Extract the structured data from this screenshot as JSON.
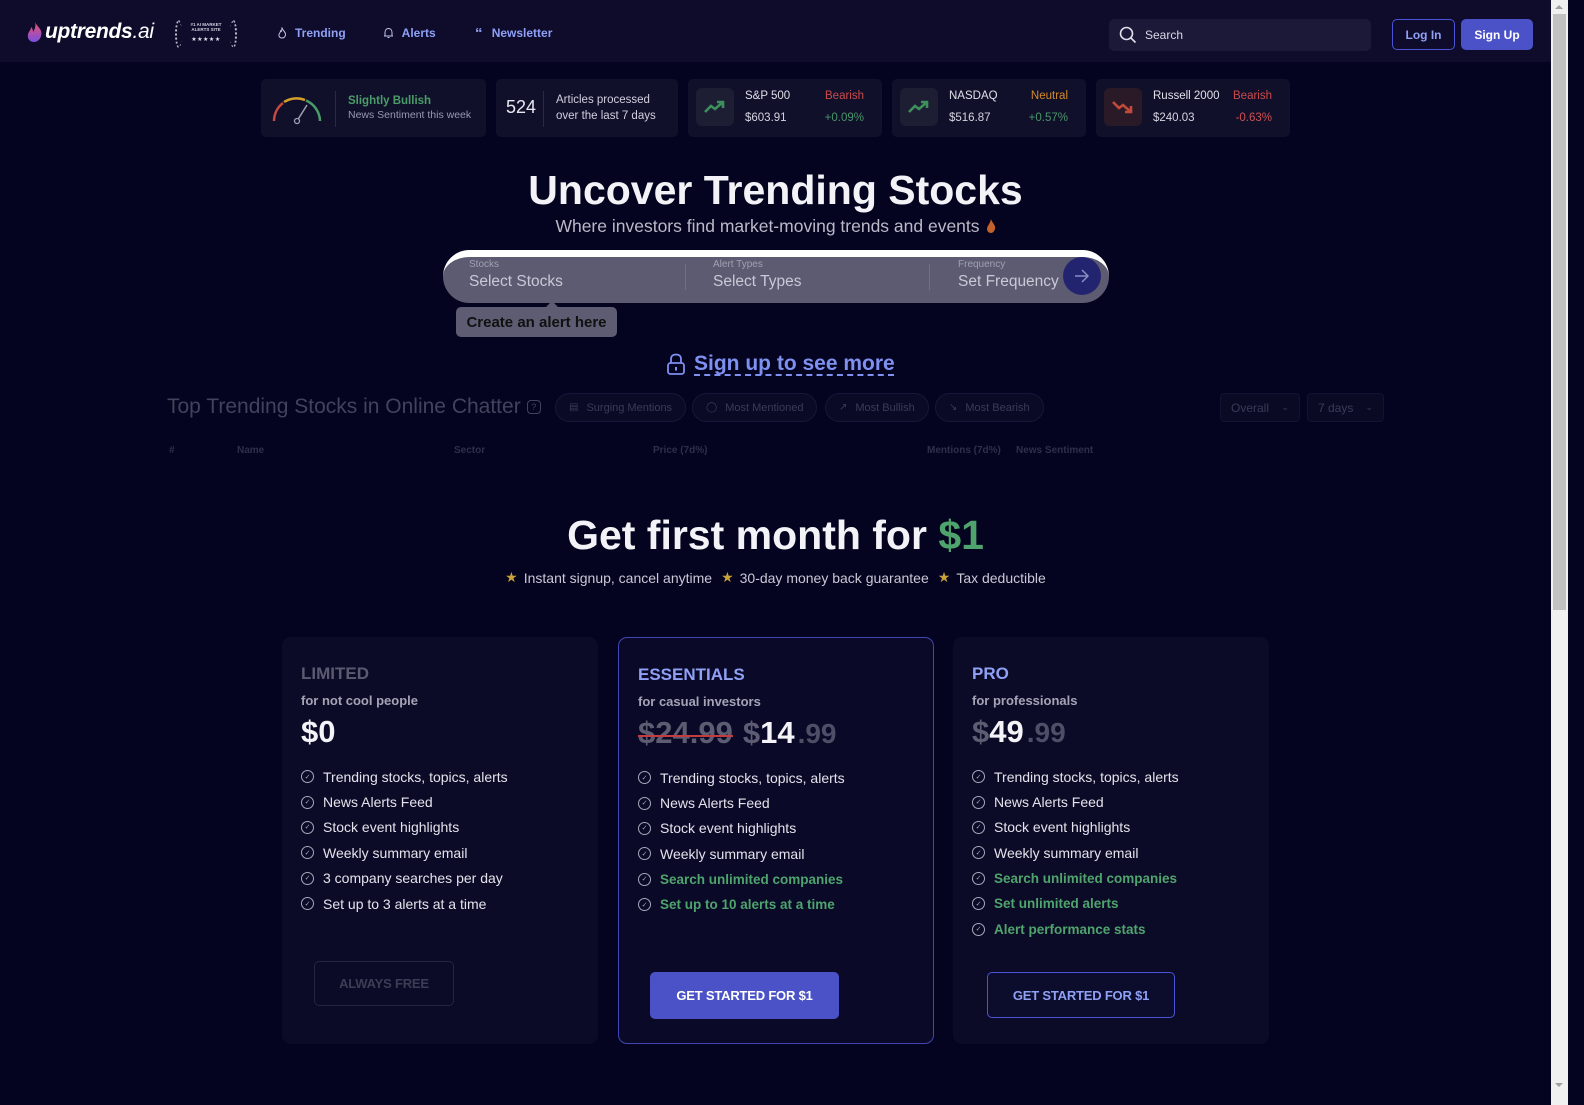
{
  "nav": {
    "logo_main": "uptrends",
    "logo_suffix": ".ai",
    "badge_text": "#1 AI MARKET ALERTS SITE",
    "badge_stars": "★★★★★",
    "links": [
      {
        "label": "Trending",
        "icon": "flame-icon"
      },
      {
        "label": "Alerts",
        "icon": "bell-icon"
      },
      {
        "label": "Newsletter",
        "icon": "quote-icon"
      }
    ],
    "search_placeholder": "Search",
    "login_label": "Log In",
    "signup_label": "Sign Up"
  },
  "ticker": {
    "sentiment": {
      "title": "Slightly Bullish",
      "subtitle": "News Sentiment this week",
      "gauge_level": "slightly bullish"
    },
    "articles": {
      "count": "524",
      "line1": "Articles processed",
      "line2": "over the last 7 days"
    },
    "indices": [
      {
        "name": "S&P 500",
        "price": "$603.91",
        "sentiment": "Bearish",
        "change": "+0.09%",
        "direction": "up"
      },
      {
        "name": "NASDAQ",
        "price": "$516.87",
        "sentiment": "Neutral",
        "change": "+0.57%",
        "direction": "up"
      },
      {
        "name": "Russell 2000",
        "price": "$240.03",
        "sentiment": "Bearish",
        "change": "-0.63%",
        "direction": "down"
      }
    ],
    "colors": {
      "bullish": "#4a9d68",
      "bearish": "#c94a4a",
      "neutral": "#d38a2a"
    }
  },
  "hero": {
    "title": "Uncover Trending Stocks",
    "subtitle": "Where investors find market-moving trends and events",
    "alert_form": {
      "stocks_label": "Stocks",
      "stocks_placeholder": "Select Stocks",
      "types_label": "Alert Types",
      "types_placeholder": "Select Types",
      "freq_label": "Frequency",
      "freq_placeholder": "Set Frequency"
    },
    "tooltip": "Create an alert here",
    "signup_more": "Sign up to see more"
  },
  "trending": {
    "title": "Top Trending Stocks in Online Chatter",
    "filters": [
      {
        "label": "Surging Mentions",
        "icon": "chart-icon"
      },
      {
        "label": "Most Mentioned",
        "icon": "chat-icon"
      },
      {
        "label": "Most Bullish",
        "icon": "arrow-up-right-icon"
      },
      {
        "label": "Most Bearish",
        "icon": "arrow-down-right-icon"
      }
    ],
    "scope_select": "Overall",
    "period_select": "7 days",
    "columns": [
      "#",
      "Name",
      "Sector",
      "Price (7d%)",
      "Mentions (7d%)",
      "News Sentiment"
    ]
  },
  "promo": {
    "title_prefix": "Get first month for ",
    "title_price": "$1",
    "perks": [
      "Instant signup, cancel anytime",
      "30-day money back guarantee",
      "Tax deductible"
    ]
  },
  "plans": [
    {
      "name": "LIMITED",
      "desc": "for not cool people",
      "price_whole": "$0",
      "features": [
        {
          "text": "Trending stocks, topics, alerts",
          "highlight": false
        },
        {
          "text": "News Alerts Feed",
          "highlight": false
        },
        {
          "text": "Stock event highlights",
          "highlight": false
        },
        {
          "text": "Weekly summary email",
          "highlight": false
        },
        {
          "text": "3 company searches per day",
          "highlight": false
        },
        {
          "text": "Set up to 3 alerts at a time",
          "highlight": false
        }
      ],
      "cta": "ALWAYS FREE"
    },
    {
      "name": "ESSENTIALS",
      "desc": "for casual investors",
      "old_price": "$24.99",
      "price_currency": "$",
      "price_whole": "14",
      "price_cents": ".99",
      "features": [
        {
          "text": "Trending stocks, topics, alerts",
          "highlight": false
        },
        {
          "text": "News Alerts Feed",
          "highlight": false
        },
        {
          "text": "Stock event highlights",
          "highlight": false
        },
        {
          "text": "Weekly summary email",
          "highlight": false
        },
        {
          "text": "Search unlimited companies",
          "highlight": true
        },
        {
          "text": "Set up to 10 alerts at a time",
          "highlight": true
        }
      ],
      "cta": "GET STARTED FOR $1"
    },
    {
      "name": "PRO",
      "desc": "for professionals",
      "price_currency": "$",
      "price_whole": "49",
      "price_cents": ".99",
      "features": [
        {
          "text": "Trending stocks, topics, alerts",
          "highlight": false
        },
        {
          "text": "News Alerts Feed",
          "highlight": false
        },
        {
          "text": "Stock event highlights",
          "highlight": false
        },
        {
          "text": "Weekly summary email",
          "highlight": false
        },
        {
          "text": "Search unlimited companies",
          "highlight": true
        },
        {
          "text": "Set unlimited alerts",
          "highlight": true
        },
        {
          "text": "Alert performance stats",
          "highlight": true
        }
      ],
      "cta": "GET STARTED FOR $1"
    }
  ],
  "colors": {
    "accent": "#4b52c8",
    "link": "#8fa0f5",
    "green": "#4ea46c",
    "background": "#050420"
  }
}
